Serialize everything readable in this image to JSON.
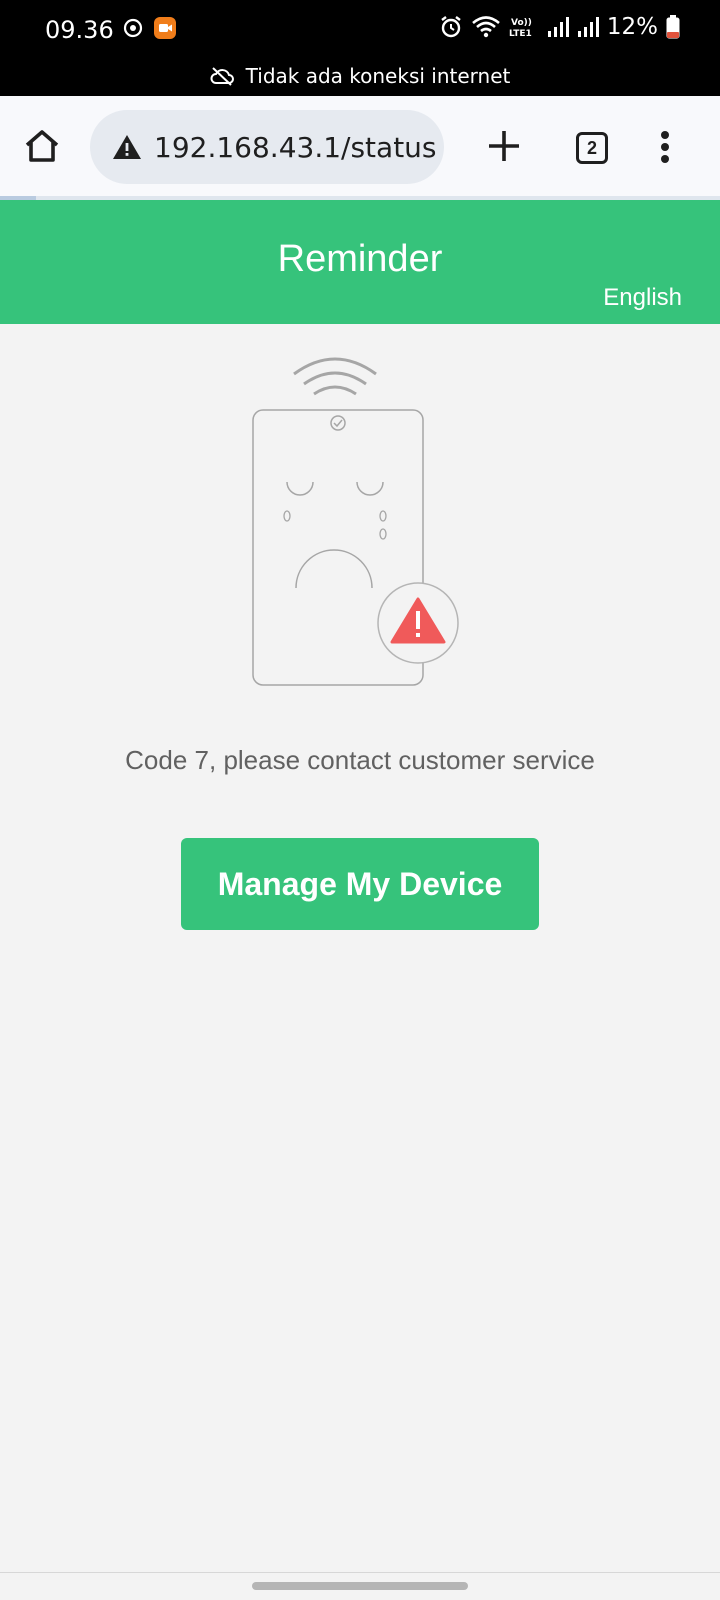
{
  "status_bar": {
    "time": "09.36",
    "battery": "12%",
    "network_label": "Vo))\nLTE1",
    "offline_message": "Tidak ada koneksi internet"
  },
  "browser": {
    "url": "192.168.43.1/status",
    "tab_count": "2"
  },
  "header": {
    "title": "Reminder",
    "language": "English"
  },
  "main": {
    "message": "Code 7, please contact customer service",
    "button_label": "Manage My Device"
  },
  "colors": {
    "accent_green": "#36c37b",
    "warning_red": "#f05a5a",
    "battery_low": "#e0533d"
  }
}
